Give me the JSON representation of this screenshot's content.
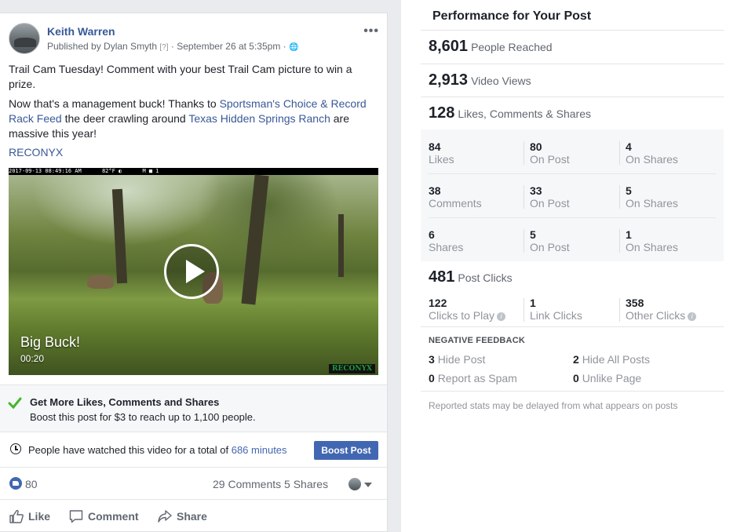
{
  "post": {
    "author": "Keith Warren",
    "published_by": "Published by Dylan Smyth",
    "help_mark": "[?]",
    "date": "September 26 at 5:35pm",
    "separator": "·",
    "globe": "🌐",
    "more": "•••",
    "text1": "Trail Cam Tuesday! Comment with your best Trail Cam picture to win a prize.",
    "text2_a": "Now that's a management buck! Thanks to ",
    "text2_link1": "Sportsman's Choice & Record Rack Feed",
    "text2_b": " the deer crawling around ",
    "text2_link2": "Texas Hidden Springs Ranch",
    "text2_c": " are massive this year!",
    "tag": "RECONYX",
    "video": {
      "cam_date": "2017-09-13 08:49:16 AM",
      "cam_temp": "82°F ◐",
      "cam_id": "M ■ 1",
      "title": "Big Buck!",
      "duration": "00:20",
      "logo": "RECONYX"
    },
    "boost_tip_title": "Get More Likes, Comments and Shares",
    "boost_tip_sub": "Boost this post for $3 to reach up to 1,100 people.",
    "watch_prefix": "People have watched this video for a total of ",
    "watch_minutes": "686 minutes",
    "boost_button": "Boost Post",
    "like_count": "80",
    "comments_shares": "29 Comments  5 Shares",
    "actions": {
      "like": "Like",
      "comment": "Comment",
      "share": "Share"
    }
  },
  "perf": {
    "title": "Performance for Your Post",
    "reached": {
      "num": "8,601",
      "label": "People Reached"
    },
    "views": {
      "num": "2,913",
      "label": "Video Views"
    },
    "engagement": {
      "num": "128",
      "label": "Likes, Comments & Shares"
    },
    "grid": [
      [
        {
          "n": "84",
          "t": "Likes"
        },
        {
          "n": "80",
          "t": "On Post"
        },
        {
          "n": "4",
          "t": "On Shares"
        }
      ],
      [
        {
          "n": "38",
          "t": "Comments"
        },
        {
          "n": "33",
          "t": "On Post"
        },
        {
          "n": "5",
          "t": "On Shares"
        }
      ],
      [
        {
          "n": "6",
          "t": "Shares"
        },
        {
          "n": "5",
          "t": "On Post"
        },
        {
          "n": "1",
          "t": "On Shares"
        }
      ]
    ],
    "clicks": {
      "num": "481",
      "label": "Post Clicks"
    },
    "click_grid": [
      {
        "n": "122",
        "t": "Clicks to Play"
      },
      {
        "n": "1",
        "t": "Link Clicks"
      },
      {
        "n": "358",
        "t": "Other Clicks"
      }
    ],
    "info_glyph": "i",
    "negative_heading": "NEGATIVE FEEDBACK",
    "negative": [
      {
        "n": "3",
        "t": "Hide Post"
      },
      {
        "n": "2",
        "t": "Hide All Posts"
      },
      {
        "n": "0",
        "t": "Report as Spam"
      },
      {
        "n": "0",
        "t": "Unlike Page"
      }
    ],
    "note": "Reported stats may be delayed from what appears on posts"
  },
  "colors": {
    "fb_blue": "#4267b2",
    "link": "#385898",
    "muted": "#90949c"
  }
}
